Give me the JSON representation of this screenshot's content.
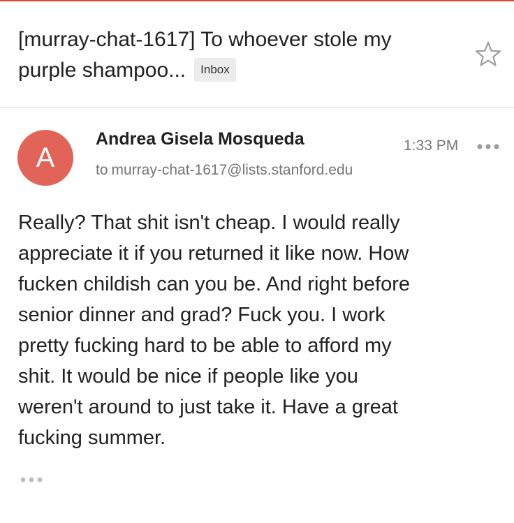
{
  "email": {
    "subject_lines": [
      "[murray-chat-1617] To whoever stole my",
      "purple shampoo..."
    ],
    "label": "Inbox",
    "starred": false,
    "sender": {
      "avatar_letter": "A",
      "avatar_color": "#e26358",
      "name": "Andrea Gisela Mosqueda",
      "to_label": "to",
      "to_address": "murray-chat-1617@lists.stanford.edu"
    },
    "time": "1:33 PM",
    "body_lines": [
      "Really? That shit isn't cheap. I would really",
      "appreciate it if you returned it like now. How",
      "fucken childish can you be. And right before",
      "senior dinner and grad? Fuck you. I work",
      "pretty fucking hard to be able to afford my",
      "shit. It would be nice if people like you",
      "weren't around to just take it. Have a great",
      "fucking summer."
    ]
  },
  "icons": {
    "star": "star-outline-icon",
    "more": "more-horizontal-icon",
    "trimmed": "show-trimmed-content-icon"
  },
  "colors": {
    "accent": "#d44b3e",
    "secondary_text": "#757575",
    "badge_bg": "#ececec"
  }
}
